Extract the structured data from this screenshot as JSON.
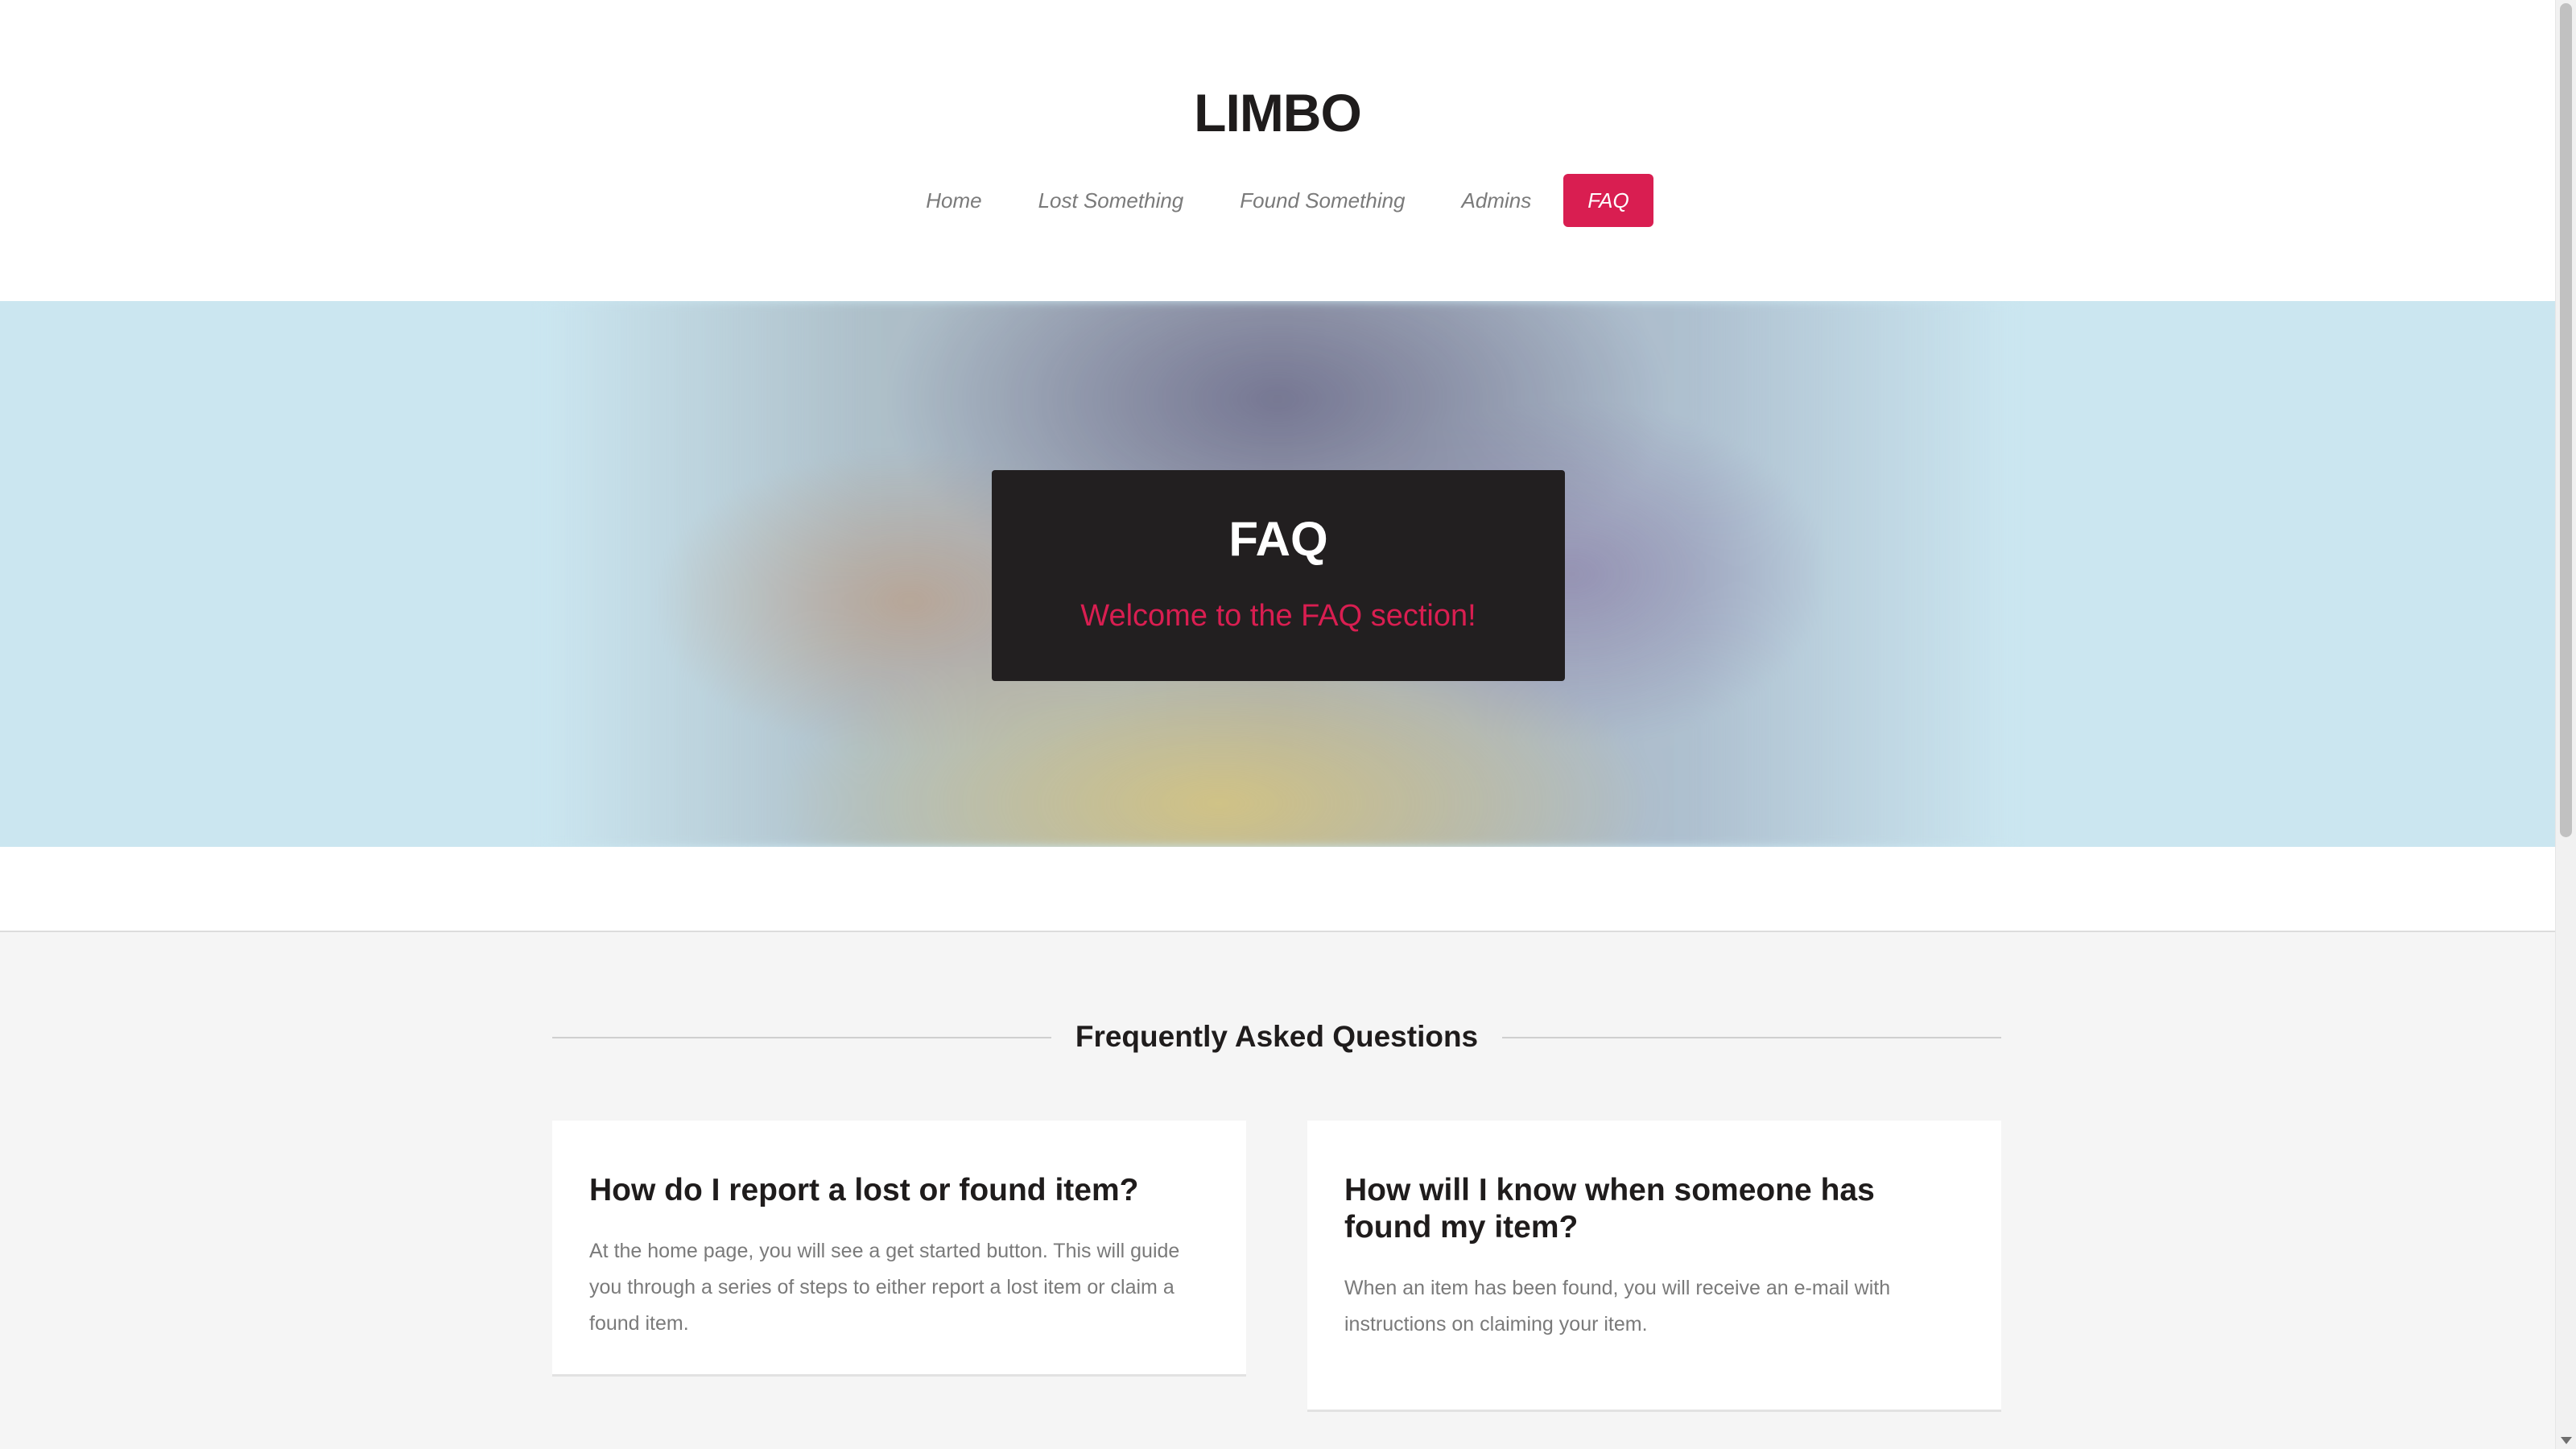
{
  "header": {
    "logo": "LIMBO",
    "nav": [
      {
        "label": "Home",
        "active": false
      },
      {
        "label": "Lost Something",
        "active": false
      },
      {
        "label": "Found Something",
        "active": false
      },
      {
        "label": "Admins",
        "active": false
      },
      {
        "label": "FAQ",
        "active": true
      }
    ]
  },
  "banner": {
    "title": "FAQ",
    "subtitle": "Welcome to the FAQ section!"
  },
  "faq": {
    "heading": "Frequently Asked Questions",
    "items": [
      {
        "question": "How do I report a lost or found item?",
        "answer": "At the home page, you will see a get started button. This will guide you through a series of steps to either report a lost item or claim a found item."
      },
      {
        "question": "How will I know when someone has found my item?",
        "answer": "When an item has been found, you will receive an e-mail with instructions on claiming your item."
      }
    ]
  },
  "colors": {
    "accent": "#d91e51",
    "dark_box": "#221f20",
    "banner_bg": "#cbe6f0",
    "section_bg": "#f5f5f5",
    "text_dark": "#1f1c1c",
    "text_muted": "#7a7a7a"
  },
  "icons": {
    "scroll_down": "scroll-down-arrow-icon"
  }
}
